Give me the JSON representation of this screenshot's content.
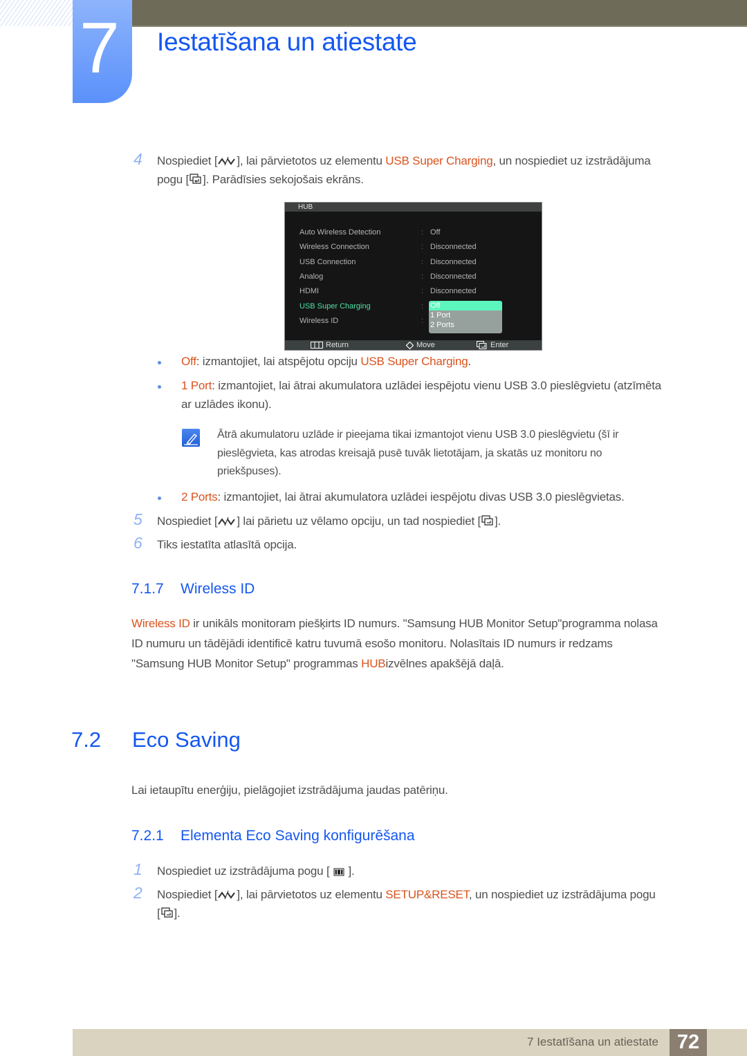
{
  "chapter": {
    "number": "7",
    "title": "Iestatīšana un atiestate"
  },
  "steps_a": [
    {
      "num": "4",
      "line1_a": "Nospiediet [",
      "line1_b": "], lai pārvietotos uz elementu ",
      "line1_hl": "USB Super Charging",
      "line1_c": ", un nospiediet uz izstrādājuma",
      "line2_a": "pogu [",
      "line2_b": "]. Parādīsies sekojošais ekrāns."
    }
  ],
  "osd": {
    "title": "HUB",
    "rows": [
      {
        "label": "Auto Wireless Detection",
        "value": "Off"
      },
      {
        "label": "Wireless Connection",
        "value": "Disconnected"
      },
      {
        "label": "USB Connection",
        "value": "Disconnected"
      },
      {
        "label": "Analog",
        "value": "Disconnected"
      },
      {
        "label": "HDMI",
        "value": "Disconnected"
      },
      {
        "label": "USB Super Charging",
        "value": ""
      },
      {
        "label": "Wireless ID",
        "value": ""
      }
    ],
    "separator": ":",
    "dropdown_options": [
      "Off",
      "1 Port",
      "2 Ports"
    ],
    "dropdown_selected": "Off",
    "footer": {
      "return": "Return",
      "move": "Move",
      "enter": "Enter"
    }
  },
  "bullets": [
    {
      "hl": "Off",
      "text": ": izmantojiet, lai atspējotu opciju ",
      "hl2": "USB Super Charging",
      "tail": "."
    },
    {
      "hl": "1 Port",
      "text": ": izmantojiet, lai ātrai akumulatora uzlādei iespējotu vienu USB 3.0 pieslēgvietu (atzīmēta",
      "line2": "ar uzlādes ikonu)."
    },
    {
      "hl": "2 Ports",
      "text": ": izmantojiet, lai ātrai akumulatora uzlādei iespējotu divas USB 3.0 pieslēgvietas."
    }
  ],
  "note": {
    "line1": "Ātrā akumulatoru uzlāde ir pieejama tikai izmantojot vienu USB 3.0 pieslēgvietu (šī ir",
    "line2": "pieslēgvieta, kas atrodas kreisajā pusē tuvāk lietotājam, ja skatās uz monitoru no",
    "line3": "priekšpuses)."
  },
  "steps_b": [
    {
      "num": "5",
      "a": "Nospiediet [",
      "b": "] lai pārietu uz vēlamo opciju, un tad nospiediet [",
      "c": "]."
    },
    {
      "num": "6",
      "text": "Tiks iestatīta atlasītā opcija."
    }
  ],
  "section_717": {
    "number": "7.1.7",
    "title": "Wireless ID",
    "para": {
      "hl1": "Wireless ID",
      "l1": " ir unikāls monitoram piešķirts ID numurs. \"Samsung HUB Monitor Setup\"programma nolasa",
      "l2": "ID numuru un tādējādi identificē katru tuvumā esošo monitoru. Nolasītais ID numurs ir redzams",
      "l3a": "\"Samsung HUB Monitor Setup\" programmas ",
      "hl2": "HUB",
      "l3b": "izvēlnes apakšējā daļā."
    }
  },
  "section_72": {
    "number": "7.2",
    "title": "Eco Saving",
    "intro": "Lai ietaupītu enerģiju, pielāgojiet izstrādājuma jaudas patēriņu."
  },
  "section_721": {
    "number": "7.2.1",
    "title": "Elementa Eco Saving konfigurēšana",
    "steps": [
      {
        "num": "1",
        "a": "Nospiediet uz izstrādājuma pogu [ ",
        "b": " ]."
      },
      {
        "num": "2",
        "a": "Nospiediet [",
        "b": "], lai pārvietotos uz elementu ",
        "hl": "SETUP&RESET",
        "c": ", un nospiediet uz izstrādājuma pogu",
        "line2_a": "[",
        "line2_b": "]."
      }
    ]
  },
  "footer": {
    "text": "7 Iestatīšana un atiestate",
    "page": "72"
  },
  "colors": {
    "heading_blue": "#1457f0",
    "highlight_orange": "#d9531e",
    "step_number": "#8fb2f5",
    "osd_active": "#4fe0a8"
  }
}
